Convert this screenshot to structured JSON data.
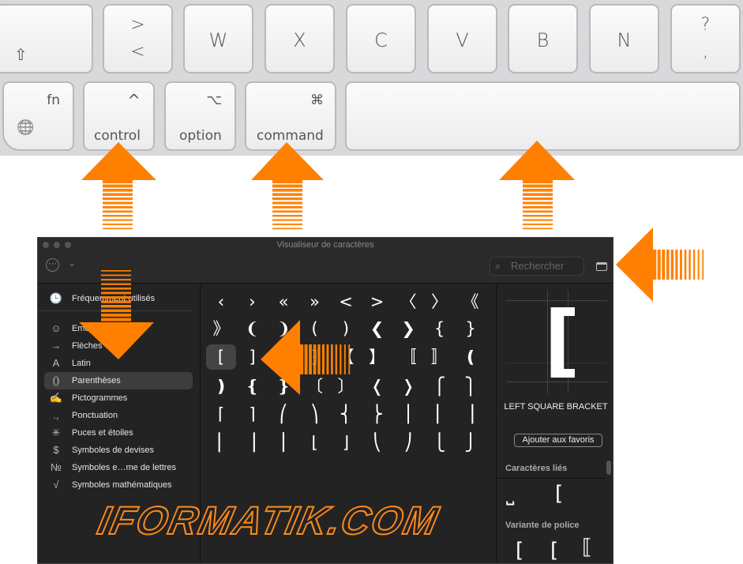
{
  "keyboard": {
    "row1": [
      {
        "id": "shift",
        "sub": "⇧"
      },
      {
        "id": "angle",
        "top": ">",
        "bottom": "<"
      },
      {
        "id": "w",
        "label": "W"
      },
      {
        "id": "x",
        "label": "X"
      },
      {
        "id": "c",
        "label": "C"
      },
      {
        "id": "v",
        "label": "V"
      },
      {
        "id": "b",
        "label": "B"
      },
      {
        "id": "n",
        "label": "N"
      },
      {
        "id": "question",
        "top": "?",
        "bottom": ","
      }
    ],
    "row2": [
      {
        "id": "fn",
        "label": "fn",
        "icon": "🌐"
      },
      {
        "id": "control",
        "label": "control",
        "symbol": "^"
      },
      {
        "id": "option",
        "label": "option",
        "symbol": "⌥"
      },
      {
        "id": "command",
        "label": "command",
        "symbol": "⌘"
      },
      {
        "id": "space",
        "label": ""
      }
    ]
  },
  "window": {
    "title": "Visualiseur de caractères",
    "toolbar": {
      "action_icon": "⋯",
      "chevron": "⌄",
      "search_placeholder": "Rechercher",
      "search_icon": "⌕"
    },
    "sidebar": [
      {
        "icon": "🕒",
        "label": "Fréquemment utilisés"
      },
      {
        "icon": "☺",
        "label": "Emoji"
      },
      {
        "icon": "→",
        "label": "Flèches"
      },
      {
        "icon": "A",
        "label": "Latin"
      },
      {
        "icon": "()",
        "label": "Parenthèses",
        "selected": true
      },
      {
        "icon": "✍",
        "label": "Pictogrammes"
      },
      {
        "icon": ".,",
        "label": "Ponctuation"
      },
      {
        "icon": "✳",
        "label": "Puces et étoiles"
      },
      {
        "icon": "$",
        "label": "Symboles de devises"
      },
      {
        "icon": "№",
        "label": "Symboles e…me de lettres"
      },
      {
        "icon": "√",
        "label": "Symboles mathématiques"
      }
    ],
    "grid": [
      [
        "‹",
        "›",
        "«",
        "»",
        "<",
        ">",
        "〈",
        "〉",
        "《"
      ],
      [
        "》",
        "❨",
        "❩",
        "(",
        ")",
        "❮",
        "❯",
        "{",
        "}"
      ],
      [
        "[",
        "]",
        "⁅",
        "⁆",
        "【",
        "】",
        "〚",
        "〛",
        "❪"
      ],
      [
        "❫",
        "❴",
        "❵",
        "〔",
        "〕",
        "❬",
        "❭",
        "⎧",
        "⎫"
      ],
      [
        "⌈",
        "⌉",
        "⎛",
        "⎞",
        "⎨",
        "⎬",
        "⎪",
        "⎢",
        "⎥"
      ],
      [
        "⎜",
        "⎟",
        "⎮",
        "⌊",
        "⌋",
        "⎝",
        "⎠",
        "⎩",
        "⎭"
      ]
    ],
    "detail": {
      "glyph": "[",
      "name": "LEFT SQUARE BRACKET",
      "favorite_button": "Ajouter aux favoris",
      "related_title": "Caractères liés",
      "related": [
        "⎵",
        "["
      ],
      "variants_title": "Variante de police",
      "variants": [
        "[",
        "[",
        "⟦"
      ]
    }
  },
  "watermark": "IFORMATIK.COM",
  "colors": {
    "arrow": "#ff8000",
    "window_bg": "#232323",
    "keyboard_bg": "#d9d9db"
  }
}
